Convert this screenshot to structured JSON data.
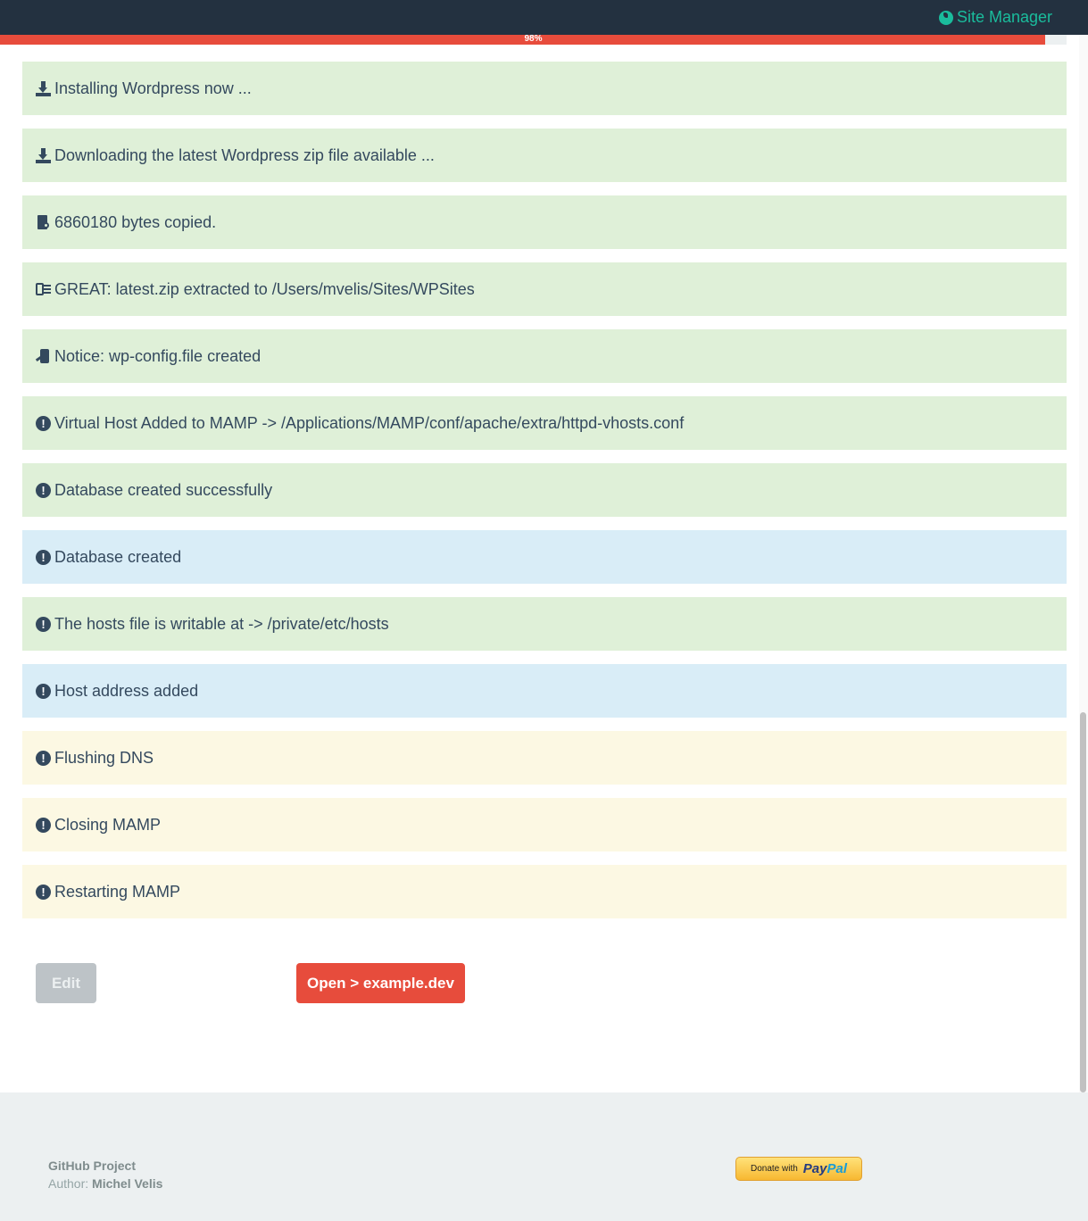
{
  "header": {
    "brand": "Site Manager"
  },
  "progress": {
    "label": "98%",
    "value": 0.98
  },
  "colors": {
    "success": "#dff0d8",
    "info": "#d9edf7",
    "warning": "#fcf8e3",
    "accent": "#e74c3c",
    "brand": "#1abc9c"
  },
  "log": [
    {
      "icon": "download-icon",
      "status": "success",
      "text": "Installing Wordpress now ..."
    },
    {
      "icon": "download-icon",
      "status": "success",
      "text": "Downloading the latest Wordpress zip file available ..."
    },
    {
      "icon": "file-copy-icon",
      "status": "success",
      "text": "6860180 bytes copied."
    },
    {
      "icon": "archive-icon",
      "status": "success",
      "text": "GREAT: latest.zip extracted to /Users/mvelis/Sites/WPSites"
    },
    {
      "icon": "config-file-icon",
      "status": "success",
      "text": "Notice: wp-config.file created"
    },
    {
      "icon": "alert-icon",
      "status": "success",
      "text": "Virtual Host Added to MAMP -> /Applications/MAMP/conf/apache/extra/httpd-vhosts.conf"
    },
    {
      "icon": "alert-icon",
      "status": "success",
      "text": "Database created successfully"
    },
    {
      "icon": "alert-icon",
      "status": "info",
      "text": "Database created"
    },
    {
      "icon": "alert-icon",
      "status": "success",
      "text": "The hosts file is writable at -> /private/etc/hosts"
    },
    {
      "icon": "alert-icon",
      "status": "info",
      "text": "Host address added"
    },
    {
      "icon": "alert-icon",
      "status": "warning",
      "text": "Flushing DNS"
    },
    {
      "icon": "alert-icon",
      "status": "warning",
      "text": "Closing MAMP"
    },
    {
      "icon": "alert-icon",
      "status": "warning",
      "text": "Restarting MAMP"
    }
  ],
  "actions": {
    "edit_label": "Edit",
    "open_label": "Open > example.dev"
  },
  "footer": {
    "project_link": "GitHub Project",
    "author_label": "Author:",
    "author_name": "Michel Velis",
    "donate_with": "Donate with",
    "paypal_pay": "Pay",
    "paypal_pal": "Pal"
  }
}
